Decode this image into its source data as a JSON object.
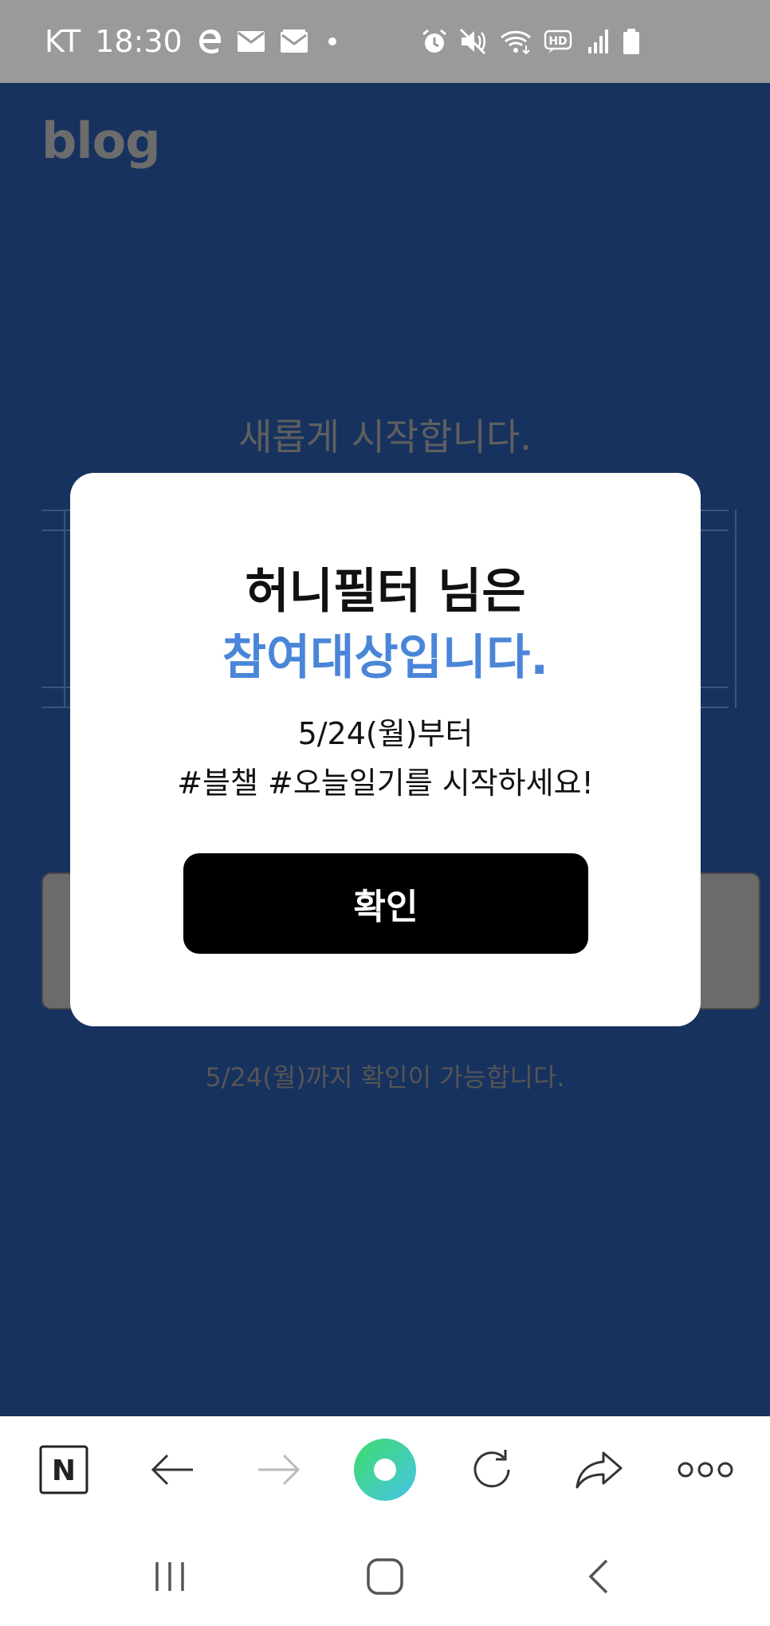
{
  "status_bar": {
    "carrier": "KT",
    "time": "18:30",
    "icons": [
      "e-browser-icon",
      "mail-icon",
      "mail-open-icon",
      "dot-icon",
      "alarm-icon",
      "mute-icon",
      "wifi-icon",
      "hd-icon",
      "signal-icon",
      "battery-icon"
    ],
    "hd_label": "HD"
  },
  "page": {
    "logo": "blog",
    "intro": "새롭게 시작합니다.",
    "notice": "5/24(월)까지 확인이 가능합니다."
  },
  "modal": {
    "title_line1": "허니필터 님은",
    "title_line2": "참여대상입니다.",
    "body_line1": "5/24(월)부터",
    "body_line2": "#블챌 #오늘일기를 시작하세요!",
    "confirm_label": "확인"
  },
  "toolbar": {
    "items": [
      "naver-home-icon",
      "back-arrow-icon",
      "forward-arrow-icon",
      "green-orb-icon",
      "refresh-icon",
      "share-icon",
      "more-icon"
    ],
    "naver_letter": "N"
  },
  "nav_bar": {
    "items": [
      "recent-apps-icon",
      "home-icon",
      "back-icon"
    ]
  },
  "colors": {
    "status_bg": "#9a9a9a",
    "page_bg": "#17325e",
    "accent_blue": "#4a86d8",
    "confirm_bg": "#000000"
  }
}
